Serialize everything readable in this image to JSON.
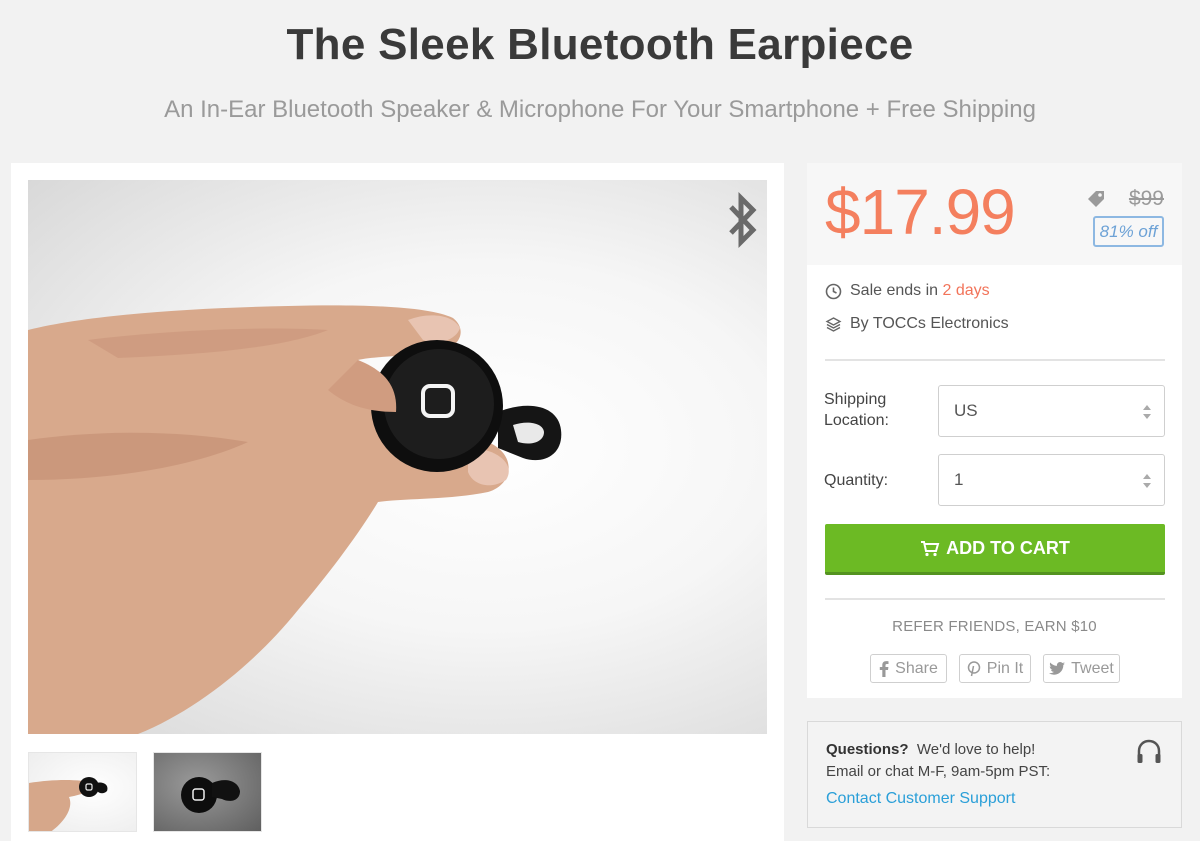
{
  "header": {
    "title": "The Sleek Bluetooth Earpiece",
    "subtitle": "An In-Ear Bluetooth Speaker & Microphone For Your Smartphone + Free Shipping"
  },
  "gallery": {
    "main_badge_icon": "bluetooth-icon",
    "thumbnails": [
      "thumbnail-hand-holding-earpiece",
      "thumbnail-earpiece-gray-background"
    ]
  },
  "pricing": {
    "price": "$17.99",
    "original_price": "$99",
    "discount": "81% off",
    "price_color": "#f47f5e"
  },
  "sale": {
    "prefix": "Sale ends in",
    "remaining": "2 days"
  },
  "seller": {
    "label": "By TOCCs Electronics"
  },
  "options": {
    "shipping_label_line1": "Shipping",
    "shipping_label_line2": "Location:",
    "shipping_value": "US",
    "quantity_label": "Quantity:",
    "quantity_value": "1"
  },
  "cart": {
    "label": "ADD TO CART",
    "color": "#6cba24"
  },
  "referral": {
    "text": "REFER FRIENDS, EARN $10",
    "share_label": "Share",
    "pin_label": "Pin It",
    "tweet_label": "Tweet"
  },
  "support": {
    "question_bold": "Questions?",
    "question_rest": "We'd love to help!",
    "hours": "Email or chat M-F, 9am-5pm PST:",
    "link": "Contact Customer Support",
    "link_color": "#2a9fd8"
  }
}
